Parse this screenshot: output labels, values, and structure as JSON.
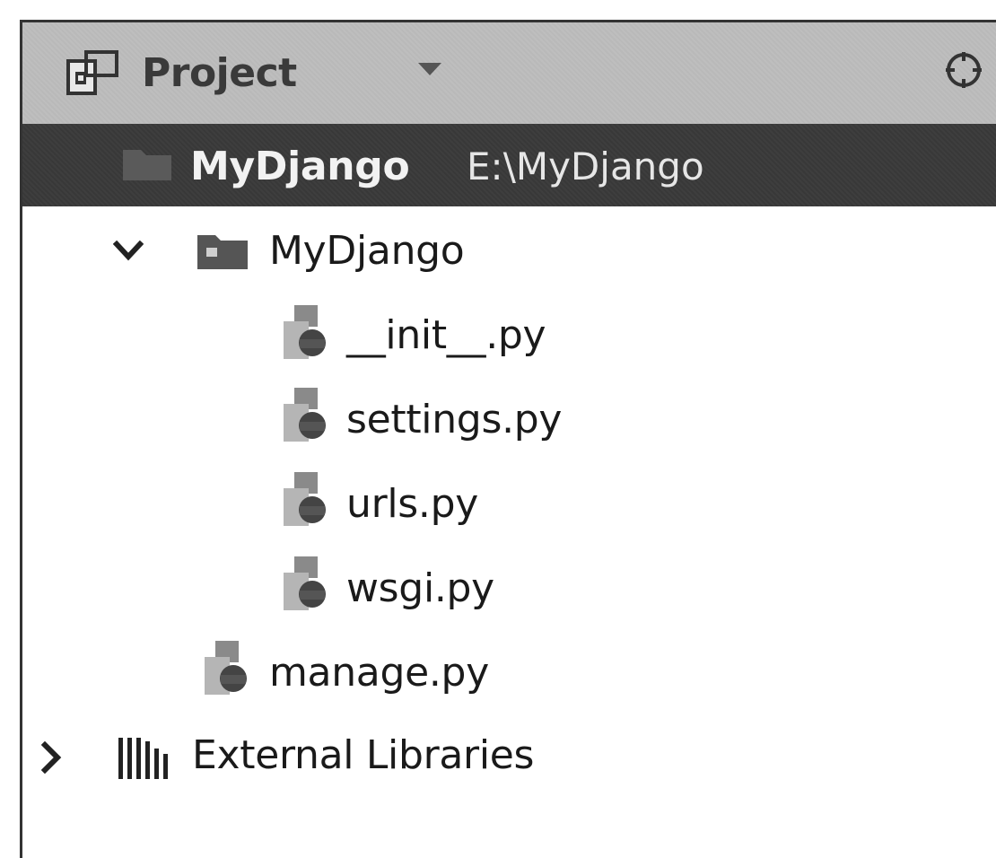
{
  "panel": {
    "title": "Project"
  },
  "tree": {
    "root": {
      "name": "MyDjango",
      "path": "E:\\MyDjango"
    },
    "package": {
      "name": "MyDjango",
      "files": [
        {
          "label": "__init__.py"
        },
        {
          "label": "settings.py"
        },
        {
          "label": "urls.py"
        },
        {
          "label": "wsgi.py"
        }
      ]
    },
    "root_files": [
      {
        "label": "manage.py"
      }
    ],
    "external": {
      "label": "External Libraries"
    }
  },
  "colors": {
    "header_bg": "#bdbdbd",
    "selected_row_bg": "#3a3a3a",
    "text": "#1a1a1a"
  },
  "icons": {
    "panel": "project-panel-icon",
    "dropdown": "chevron-down-icon",
    "target": "target-icon",
    "folder": "folder-icon",
    "python_file": "python-file-icon",
    "libraries": "libraries-icon",
    "expand": "chevron-right-icon"
  }
}
